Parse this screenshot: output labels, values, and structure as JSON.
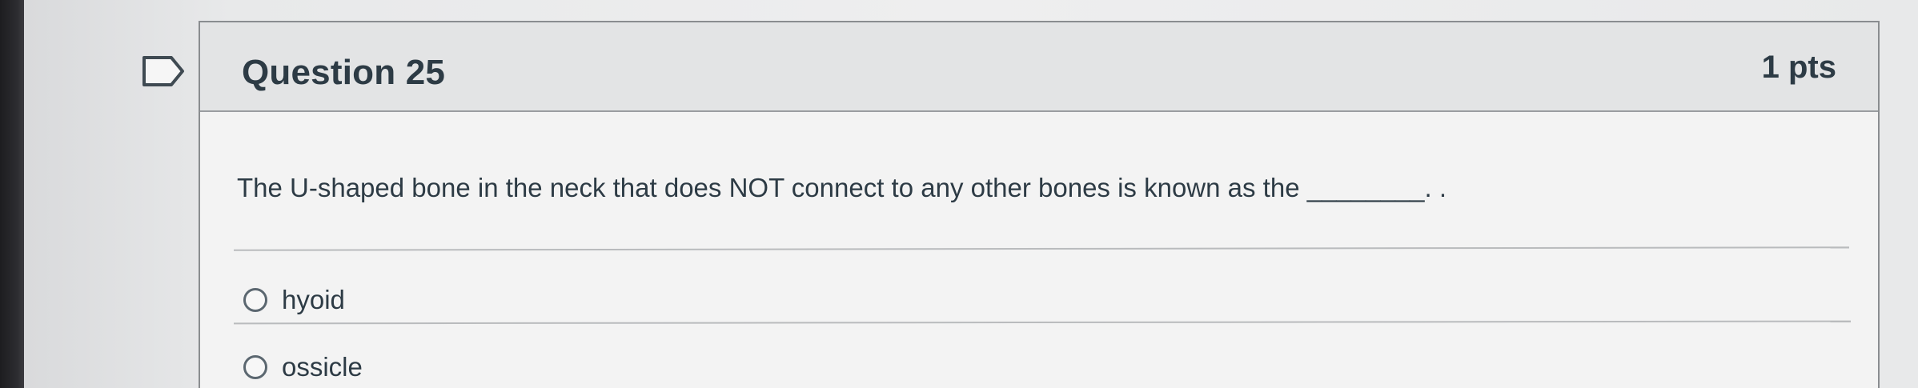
{
  "question": {
    "title": "Question 25",
    "points": "1 pts",
    "text": "The U-shaped bone in the neck that does NOT connect to any other bones is known as the ________. .",
    "answers": [
      {
        "label": "hyoid",
        "selected": false
      },
      {
        "label": "ossicle",
        "selected": false
      }
    ]
  },
  "icons": {
    "flag": "flag-icon",
    "radio": "radio-unselected-icon"
  },
  "colors": {
    "header_bg": "#e3e4e5",
    "text": "#2d3b45",
    "border": "#8a8d90"
  }
}
